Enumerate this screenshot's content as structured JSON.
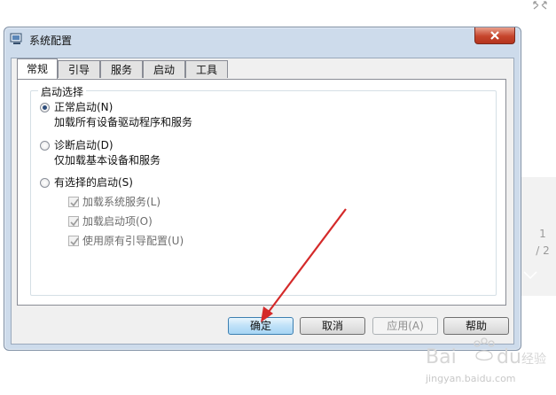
{
  "window": {
    "title": "系统配置",
    "tabs": [
      {
        "label": "常规",
        "active": true
      },
      {
        "label": "引导",
        "active": false
      },
      {
        "label": "服务",
        "active": false
      },
      {
        "label": "启动",
        "active": false
      },
      {
        "label": "工具",
        "active": false
      }
    ],
    "group_title": "启动选择",
    "options": [
      {
        "label": "正常启动(N)",
        "description": "加载所有设备驱动程序和服务",
        "selected": true
      },
      {
        "label": "诊断启动(D)",
        "description": "仅加载基本设备和服务",
        "selected": false
      },
      {
        "label": "有选择的启动(S)",
        "selected": false
      }
    ],
    "selective_items": [
      {
        "label": "加载系统服务(L)",
        "checked": true
      },
      {
        "label": "加载启动项(O)",
        "checked": true
      },
      {
        "label": "使用原有引导配置(U)",
        "checked": true
      }
    ],
    "buttons": {
      "ok": "确定",
      "cancel": "取消",
      "apply": "应用(A)",
      "help": "帮助"
    }
  },
  "viewer": {
    "page_current": "1",
    "page_total": "/ 2"
  },
  "watermark": {
    "text": "Bai du 经验",
    "url": "jingyan.baidu.com"
  },
  "colors": {
    "annotation_arrow": "#d42a2a",
    "window_frame": "#cddbeb",
    "close_button": "#c6452c"
  },
  "icons": [
    "expand-icon",
    "app-icon",
    "close-icon",
    "check-icon",
    "chevron-down-icon"
  ]
}
